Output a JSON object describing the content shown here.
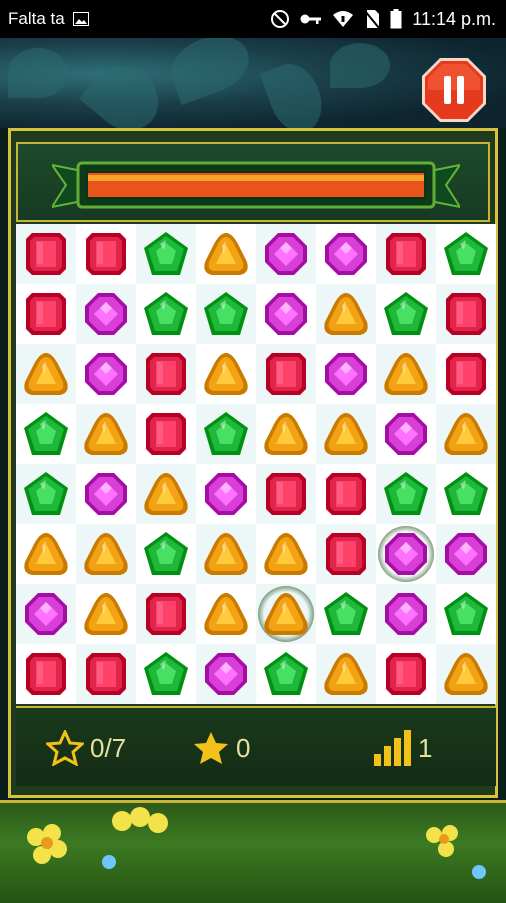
{
  "status_bar": {
    "notification_text": "Falta ta",
    "time": "11:14 p.m.",
    "icons": [
      "image-icon",
      "do-not-disturb-icon",
      "key-icon",
      "wifi-icon",
      "no-sim-icon",
      "battery-icon"
    ]
  },
  "header": {
    "pause_icon": "pause-icon",
    "progress_fraction": 1.0,
    "progress_colors": {
      "fill": "#e8541a",
      "highlight": "#f6a12a"
    }
  },
  "board": {
    "columns": 8,
    "rows": 8,
    "grid": [
      [
        "red",
        "red",
        "green",
        "orange",
        "purple",
        "purple",
        "red",
        "green"
      ],
      [
        "red",
        "purple",
        "green",
        "green",
        "purple",
        "orange",
        "green",
        "red"
      ],
      [
        "orange",
        "purple",
        "red",
        "orange",
        "red",
        "purple",
        "orange",
        "red"
      ],
      [
        "green",
        "orange",
        "red",
        "green",
        "orange",
        "orange",
        "purple",
        "orange"
      ],
      [
        "green",
        "purple",
        "orange",
        "purple",
        "red",
        "red",
        "green",
        "green"
      ],
      [
        "orange",
        "orange",
        "green",
        "orange",
        "orange",
        "red",
        "purple",
        "purple"
      ],
      [
        "purple",
        "orange",
        "red",
        "orange",
        "orange",
        "green",
        "purple",
        "green"
      ],
      [
        "red",
        "red",
        "green",
        "purple",
        "green",
        "orange",
        "red",
        "orange"
      ]
    ],
    "highlighted_cells": [
      [
        5,
        6
      ],
      [
        6,
        4
      ]
    ],
    "gem_colors": {
      "red": "#e0244c",
      "green": "#1fb83a",
      "orange": "#f2a213",
      "purple": "#d83fd6"
    }
  },
  "footer": {
    "stars_collected": "0/7",
    "score": "0",
    "level": "1",
    "star_outline_icon": "star-outline-icon",
    "star_icon": "star-icon",
    "level_icon": "signal-bars-icon"
  }
}
